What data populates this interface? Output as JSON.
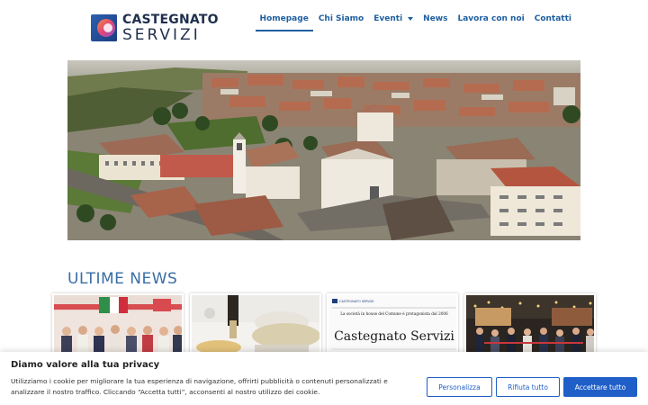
{
  "brand": {
    "name_top": "CASTEGNATO",
    "name_bottom": "SERVIZI"
  },
  "nav": {
    "items": [
      {
        "label": "Homepage",
        "active": true
      },
      {
        "label": "Chi Siamo"
      },
      {
        "label": "Eventi",
        "dropdown": true
      },
      {
        "label": "News"
      },
      {
        "label": "Lavora con noi"
      },
      {
        "label": "Contatti"
      }
    ]
  },
  "main": {
    "section_title": "ULTIME NEWS",
    "news": [
      {
        "image": "group-photo-flags"
      },
      {
        "image": "wine-glasses-table"
      },
      {
        "image": "newspaper-clipping",
        "caption_small": "La società in house del Comune è protagonista dal 2006",
        "headline": "Castegnato Servizi",
        "logo_text": "CASTEGNATO SERVIZI"
      },
      {
        "image": "night-ribbon-cutting"
      }
    ]
  },
  "cookie_banner": {
    "title": "Diamo valore alla tua privacy",
    "text": "Utilizziamo i cookie per migliorare la tua esperienza di navigazione, offrirti pubblicità o contenuti personalizzati e analizzare il nostro traffico. Cliccando “Accetta tutti”, acconsenti al nostro utilizzo dei cookie.",
    "buttons": {
      "customize": "Personalizza",
      "reject": "Rifiuta tutto",
      "accept": "Accettare tutto"
    }
  },
  "colors": {
    "accent": "#1f5fa0",
    "button": "#1f5fc7",
    "title": "#3a6ea5"
  }
}
